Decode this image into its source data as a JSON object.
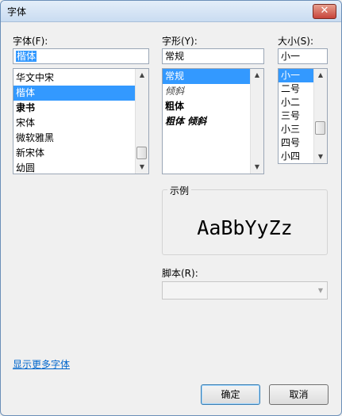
{
  "window": {
    "title": "字体",
    "close_glyph": "✕"
  },
  "font": {
    "label": "字体(F):",
    "value": "楷体",
    "items": [
      "华文中宋",
      "楷体",
      "隶书",
      "宋体",
      "微软雅黑",
      "新宋体",
      "幼圆"
    ],
    "selected_index": 1
  },
  "style": {
    "label": "字形(Y):",
    "value": "常规",
    "items": [
      "常规",
      "倾斜",
      "粗体",
      "粗体 倾斜"
    ],
    "selected_index": 0
  },
  "size": {
    "label": "大小(S):",
    "value": "小一",
    "items": [
      "小一",
      "二号",
      "小二",
      "三号",
      "小三",
      "四号",
      "小四"
    ],
    "selected_index": 0
  },
  "preview": {
    "label": "示例",
    "text": "AaBbYyZz"
  },
  "script": {
    "label": "脚本(R):",
    "value": ""
  },
  "links": {
    "more_fonts": "显示更多字体"
  },
  "buttons": {
    "ok": "确定",
    "cancel": "取消"
  },
  "icons": {
    "scroll_up": "▲",
    "scroll_down": "▼",
    "dropdown": "▼"
  },
  "colors": {
    "selection": "#3399ff",
    "link": "#0066cc"
  }
}
